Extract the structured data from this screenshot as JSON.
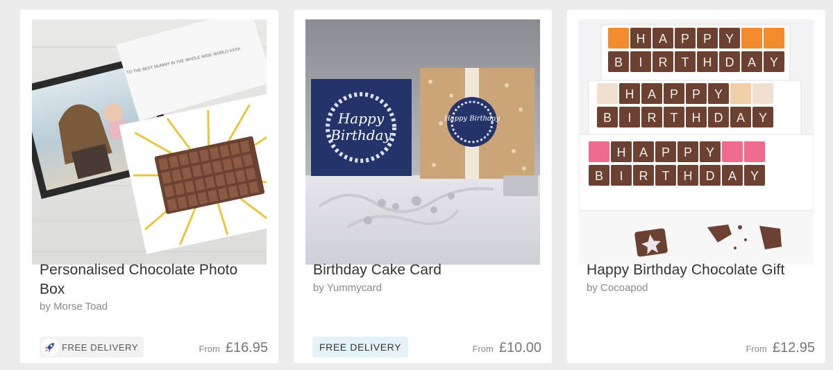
{
  "products": [
    {
      "title": "Personalised Chocolate Photo Box",
      "maker": "by Morse Toad",
      "badge": "FREE DELIVERY",
      "price_prefix": "From",
      "price": "£16.95",
      "image_text": "TO THE BEST MUMMY IN THE WHOLE WIDE WORLD XXXX"
    },
    {
      "title": "Birthday Cake Card",
      "maker": "by Yummycard",
      "badge": "FREE DELIVERY",
      "price_prefix": "From",
      "price": "£10.00",
      "image_text": "Happy Birthday"
    },
    {
      "title": "Happy Birthday Chocolate Gift",
      "maker": "by Cocoapod",
      "price_prefix": "From",
      "price": "£12.95",
      "image_text": "HAPPY BIRTHDAY"
    }
  ],
  "colors": {
    "card_bg": "#ffffff",
    "page_bg": "#ececec",
    "badge_plain_bg": "#e3f3f8",
    "chocolate": "#6b4232",
    "navy": "#24336a"
  },
  "icons": [
    "rocket-icon"
  ]
}
